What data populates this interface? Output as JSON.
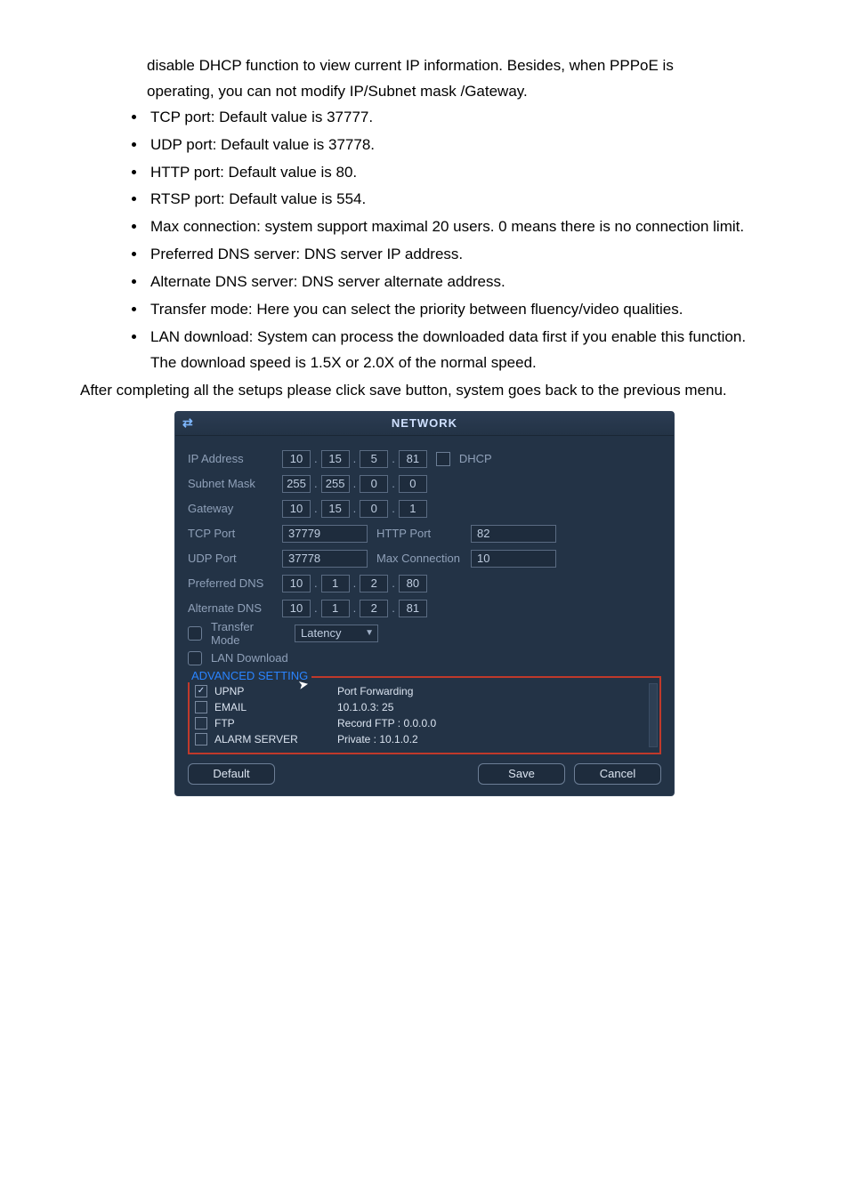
{
  "body": {
    "lead_lines": [
      "disable DHCP function to view current IP information.    Besides, when PPPoE is",
      "operating, you can not modify IP/Subnet mask /Gateway."
    ],
    "bullets": [
      "TCP port: Default value is 37777.",
      "UDP port: Default value is 37778.",
      "HTTP port: Default value is 80.",
      "RTSP port: Default value is 554.",
      "Max connection: system support maximal 20 users. 0 means there is no connection limit.",
      "Preferred DNS server: DNS server IP address.",
      "Alternate DNS server: DNS server alternate address.",
      "Transfer mode: Here you can select the priority between fluency/video qualities.",
      "LAN download: System can process the downloaded data first if you enable this function. The download speed is 1.5X or 2.0X of the normal speed."
    ],
    "closing": "After completing all the setups please click save button, system goes back to the previous menu."
  },
  "dlg": {
    "title": "NETWORK",
    "icon_glyph": "⇄",
    "labels": {
      "ip": "IP Address",
      "mask": "Subnet Mask",
      "gw": "Gateway",
      "tcp": "TCP Port",
      "udp": "UDP Port",
      "http": "HTTP Port",
      "maxc": "Max Connection",
      "pdns": "Preferred DNS",
      "adns": "Alternate DNS",
      "tmode": "Transfer Mode",
      "landl": "LAN Download",
      "dhcp": "DHCP",
      "adv": "ADVANCED SETTING"
    },
    "values": {
      "ip": [
        "10",
        "15",
        "5",
        "81"
      ],
      "mask": [
        "255",
        "255",
        "0",
        "0"
      ],
      "gw": [
        "10",
        "15",
        "0",
        "1"
      ],
      "tcp": "37779",
      "http": "82",
      "udp": "37778",
      "maxc": "10",
      "pdns": [
        "10",
        "1",
        "2",
        "80"
      ],
      "adns": [
        "10",
        "1",
        "2",
        "81"
      ],
      "tmode": "Latency"
    },
    "advlist": [
      {
        "name": "UPNP",
        "desc": "Port Forwarding",
        "checked": true
      },
      {
        "name": "EMAIL",
        "desc": "10.1.0.3: 25",
        "checked": false
      },
      {
        "name": "FTP",
        "desc": "Record FTP : 0.0.0.0",
        "checked": false
      },
      {
        "name": "ALARM SERVER",
        "desc": "Private : 10.1.0.2",
        "checked": false
      }
    ],
    "buttons": {
      "default": "Default",
      "save": "Save",
      "cancel": "Cancel"
    }
  }
}
